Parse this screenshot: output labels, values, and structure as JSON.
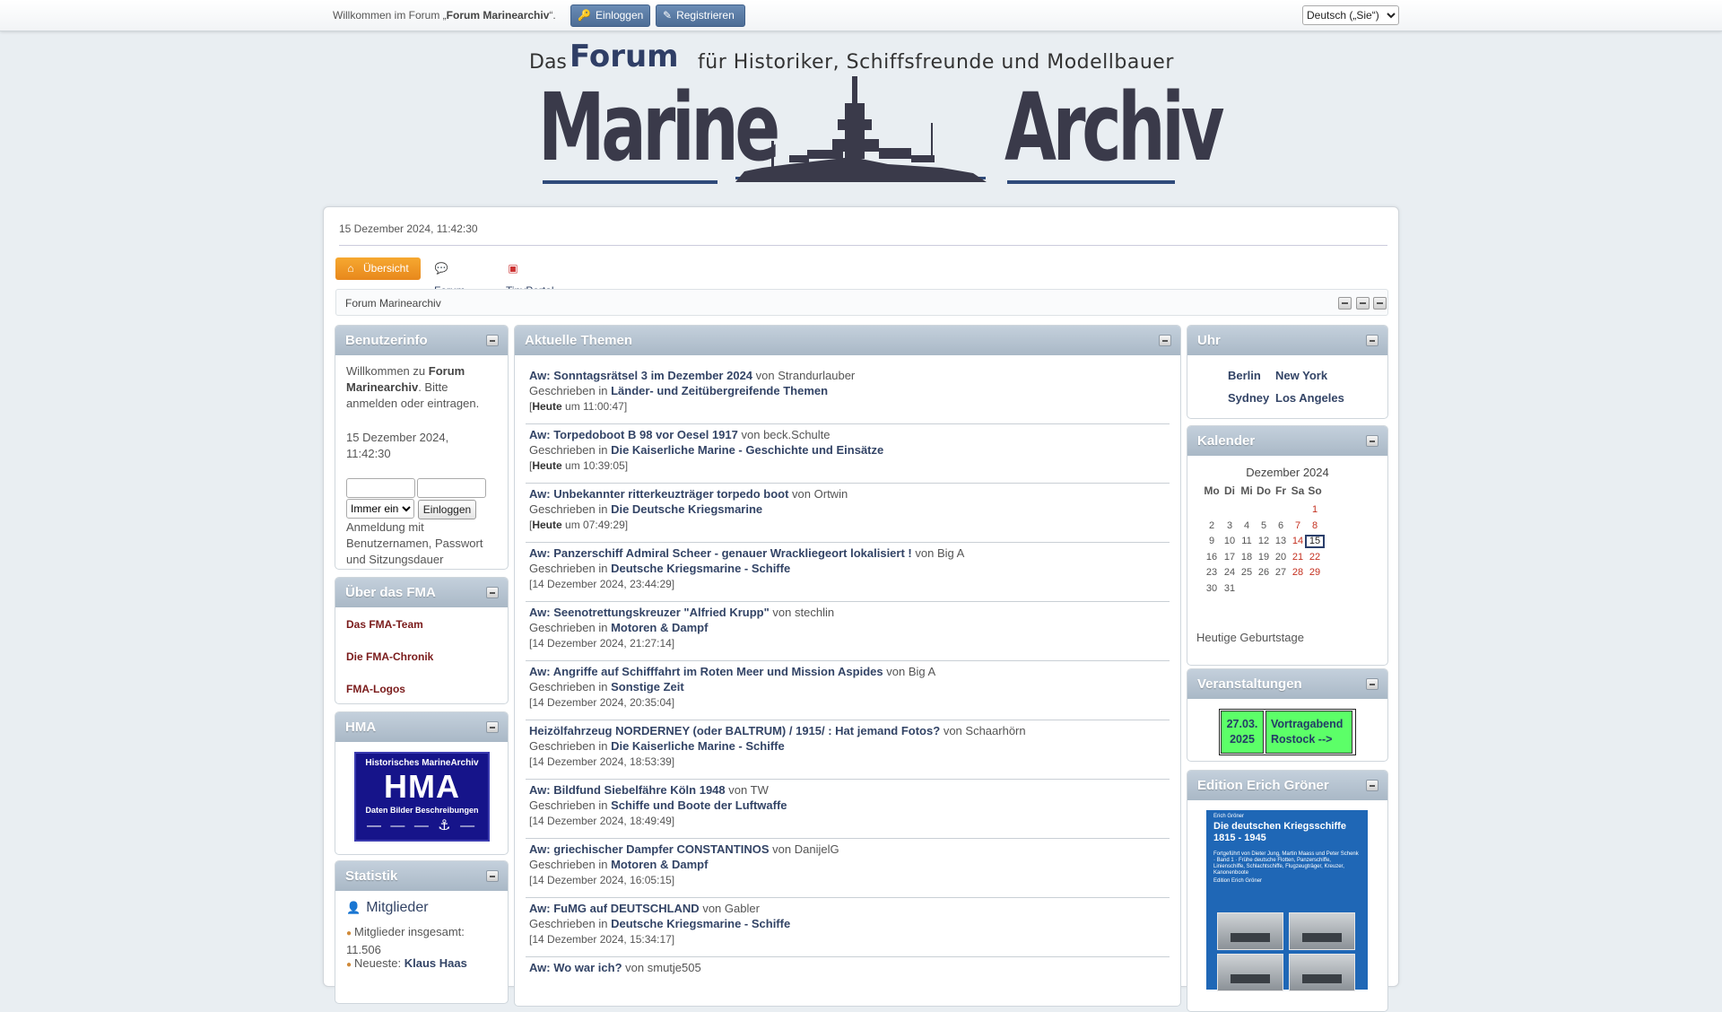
{
  "topbar": {
    "welcome_prefix": "Willkommen im Forum „",
    "welcome_forum": "Forum Marinearchiv",
    "welcome_suffix": "“.",
    "login_label": "Einloggen",
    "register_label": "Registrieren",
    "language_selected": "Deutsch („Sie“)"
  },
  "banner": {
    "das": "Das",
    "forum": "Forum",
    "subtitle": "für Historiker, Schiffsfreunde und Modellbauer",
    "marine": "Marine",
    "archiv": "Archiv"
  },
  "header": {
    "datetime": "15 Dezember 2024, 11:42:30"
  },
  "nav": {
    "items": [
      {
        "label": "Übersicht",
        "icon": "home-icon",
        "active": true
      },
      {
        "label": "Forum",
        "icon": "forum-icon",
        "active": false
      },
      {
        "label": "TinyPortal",
        "icon": "blocks-icon",
        "active": false
      }
    ]
  },
  "linktree": {
    "label": "Forum Marinearchiv"
  },
  "userinfo": {
    "title": "Benutzerinfo",
    "welcome": "Willkommen zu",
    "forum": "Forum Marinearchiv",
    "bitte": ". Bitte",
    "anmelden": "anmelden",
    "oder": "oder",
    "eintragen": "eintragen",
    "dot": ".",
    "datetime_line1": "15 Dezember 2024,",
    "datetime_line2": "11:42:30",
    "duration_selected": "Immer eingeloggt",
    "login_button": "Einloggen",
    "hint": "Anmeldung mit Benutzernamen, Passwort und Sitzungsdauer"
  },
  "about": {
    "title": "Über das FMA",
    "links": [
      "Das FMA-Team",
      "Die FMA-Chronik",
      "FMA-Logos"
    ]
  },
  "hma": {
    "title": "HMA",
    "logo_top": "Historisches MarineArchiv",
    "logo_main": "HMA",
    "logo_sub": "Daten Bilder Beschreibungen"
  },
  "stats": {
    "title": "Statistik",
    "members_heading": "Mitglieder",
    "total_label": "Mitglieder insgesamt:",
    "total_value": "11.506",
    "newest_label": "Neueste:",
    "newest_value": "Klaus Haas"
  },
  "topics": {
    "title": "Aktuelle Themen",
    "written_in": "Geschrieben in",
    "by": "von",
    "items": [
      {
        "title": "Aw: Sonntagsrätsel 3 im Dezember 2024",
        "author": "Strandurlauber",
        "board": "Länder- und Zeitübergreifende Themen",
        "day": "Heute",
        "time": " um 11:00:47]"
      },
      {
        "title": "Aw: Torpedoboot B 98 vor Oesel 1917",
        "author": "beck.Schulte",
        "board": "Die Kaiserliche Marine - Geschichte und Einsätze",
        "day": "Heute",
        "time": " um 10:39:05]"
      },
      {
        "title": "Aw: Unbekannter ritterkeuzträger torpedo boot",
        "author": "Ortwin",
        "board": "Die Deutsche Kriegsmarine",
        "day": "Heute",
        "time": " um 07:49:29]"
      },
      {
        "title": "Aw: Panzerschiff Admiral Scheer - genauer Wrackliegeort lokalisiert !",
        "author": "Big A",
        "board": "Deutsche Kriegsmarine - Schiffe",
        "day": "",
        "time": "14 Dezember 2024, 23:44:29]"
      },
      {
        "title": "Aw: Seenotrettungskreuzer \"Alfried Krupp\"",
        "author": "stechlin",
        "board": "Motoren & Dampf",
        "day": "",
        "time": "14 Dezember 2024, 21:27:14]"
      },
      {
        "title": "Aw: Angriffe auf Schifffahrt im Roten Meer und Mission Aspides",
        "author": "Big A",
        "board": "Sonstige Zeit",
        "day": "",
        "time": "14 Dezember 2024, 20:35:04]"
      },
      {
        "title": "Heizölfahrzeug NORDERNEY (oder BALTRUM) / 1915/ : Hat jemand Fotos?",
        "author": "Schaarhörn",
        "board": "Die Kaiserliche Marine - Schiffe",
        "day": "",
        "time": "14 Dezember 2024, 18:53:39]"
      },
      {
        "title": "Aw: Bildfund Siebelfähre Köln 1948",
        "author": "TW",
        "board": "Schiffe und Boote der Luftwaffe",
        "day": "",
        "time": "14 Dezember 2024, 18:49:49]"
      },
      {
        "title": "Aw: griechischer Dampfer CONSTANTINOS",
        "author": "DanijelG",
        "board": "Motoren & Dampf",
        "day": "",
        "time": "14 Dezember 2024, 16:05:15]"
      },
      {
        "title": "Aw: FuMG auf DEUTSCHLAND",
        "author": "Gabler",
        "board": "Deutsche Kriegsmarine - Schiffe",
        "day": "",
        "time": "14 Dezember 2024, 15:34:17]"
      },
      {
        "title": "Aw: Wo war ich?",
        "author": "smutje505",
        "board": "",
        "day": "",
        "time": ""
      }
    ]
  },
  "clock": {
    "title": "Uhr",
    "cities": [
      "Berlin",
      "New York",
      "Sydney",
      "Los Angeles"
    ]
  },
  "calendar": {
    "title": "Kalender",
    "month": "Dezember 2024",
    "weekdays": [
      "Mo",
      "Di",
      "Mi",
      "Do",
      "Fr",
      "Sa",
      "So"
    ],
    "first_weekday_index": 6,
    "days_in_month": 31,
    "today": 15,
    "birthdays_label": "Heutige Geburtstage"
  },
  "events": {
    "title": "Veranstaltungen",
    "date": "27.03. 2025",
    "event": "Vortragabend Rostock -->",
    "color": "#5cff68"
  },
  "groener": {
    "title": "Edition Erich Gröner",
    "book_author": "Erich Gröner",
    "book_title": "Die deutschen Kriegsschiffe 1815 - 1945",
    "book_sub": "Fortgeführt von Dieter Jung, Martin Maass und Peter Schenk · Band 1 · Frühe deutsche Flotten, Panzerschiffe, Linienschiffe, Schlachtschiffe, Flugzeugträger, Kreuzer, Kanonenboote",
    "book_edition": "Edition Erich Gröner"
  },
  "colors": {
    "accent_nav": "#e8881c",
    "panel_header": "#a9b8c6",
    "link": "#334466",
    "weekend": "#c4301f"
  }
}
